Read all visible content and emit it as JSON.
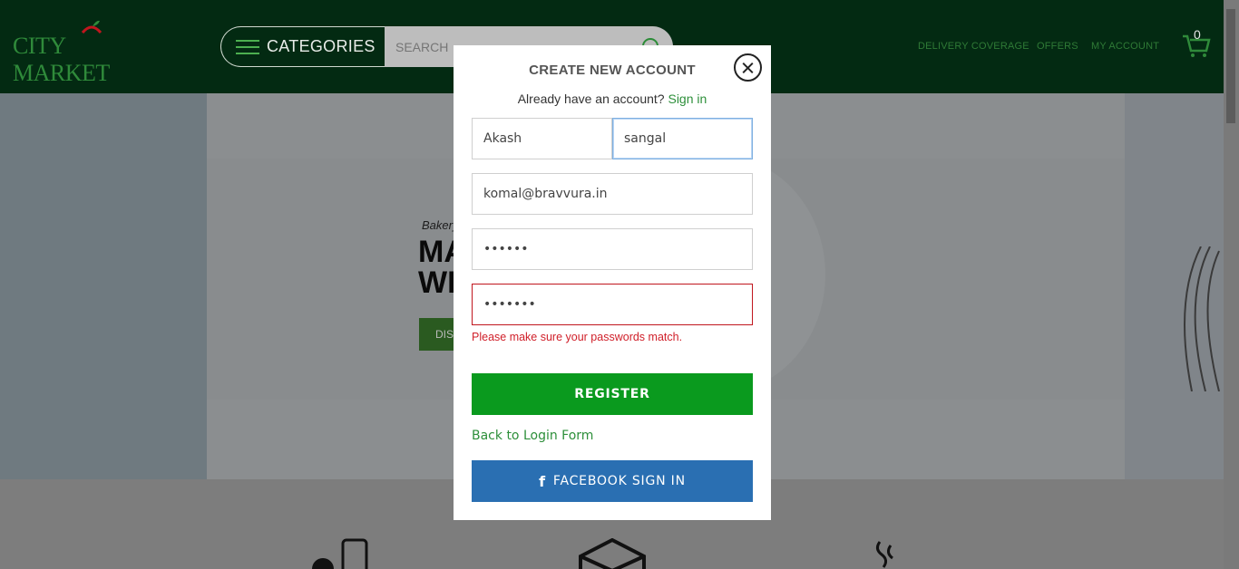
{
  "header": {
    "logo_text": "CITY MARKET",
    "categories_label": "CATEGORIES",
    "search_placeholder": "SEARCH",
    "nav": [
      "DELIVERY COVERAGE",
      "OFFERS",
      "MY ACCOUNT"
    ],
    "cart_count": "0"
  },
  "hero": {
    "subtitle": "Bakery",
    "title_line1": "MA",
    "title_line2": "WI",
    "button_label": "DIS"
  },
  "modal": {
    "title": "CREATE NEW ACCOUNT",
    "have_account": "Already have an account?",
    "sign_in_link": "Sign in",
    "first_name_value": "Akash",
    "last_name_value": "sangal",
    "email_value": "komal@bravvura.in",
    "password_value": "••••••",
    "confirm_password_value": "•••••••",
    "error_message": "Please make sure your passwords match.",
    "register_label": "REGISTER",
    "back_link": "Back to Login Form",
    "facebook_label": "FACEBOOK SIGN IN"
  },
  "colors": {
    "header_bg": "#032a12",
    "brand_green": "#0a9a1e",
    "facebook_blue": "#2a6fb2",
    "error_red": "#c0161e"
  }
}
